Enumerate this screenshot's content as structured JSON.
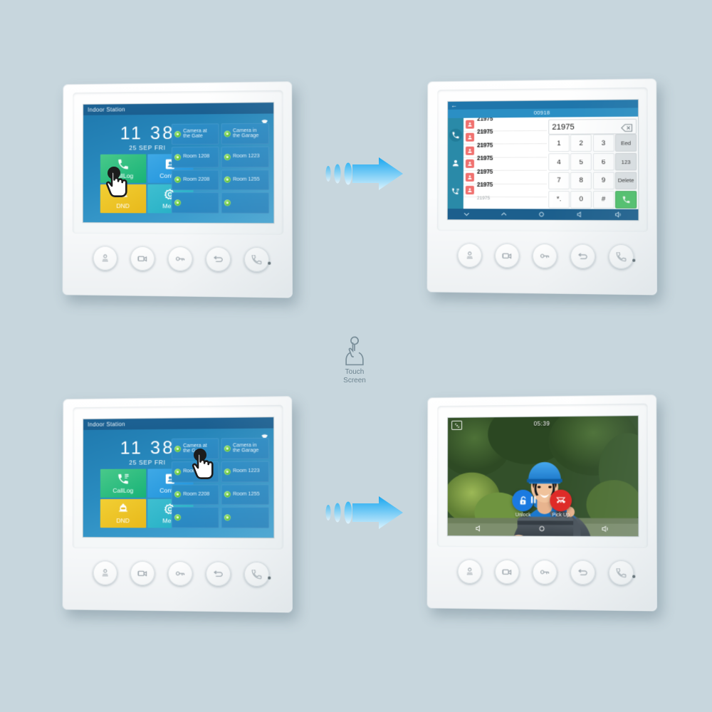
{
  "background_color": "#c7d6dd",
  "center_note": {
    "icon": "touch-hand-icon",
    "line1": "Touch",
    "line2": "Screen"
  },
  "devices": {
    "top_left": {
      "name": "indoor-station-home-calllog",
      "screen_type": "home",
      "status_bar_title": "Indoor Station",
      "wifi_icon": "wifi-icon",
      "clock": {
        "time": "11 38",
        "date": "25 SEP FRI"
      },
      "function_tiles": [
        {
          "label": "CallLog",
          "icon": "call-log-icon",
          "color": "#18b378"
        },
        {
          "label": "Contact",
          "icon": "contact-book-icon",
          "color": "#1f93dc"
        },
        {
          "label": "DND",
          "icon": "dnd-icon",
          "color": "#e8b91b"
        },
        {
          "label": "Menu",
          "icon": "gear-icon",
          "color": "#23aec4"
        }
      ],
      "room_tiles": [
        {
          "label": "Camera at\nthe Gate",
          "status": "online"
        },
        {
          "label": "Camera in\nthe Garage",
          "status": "online"
        },
        {
          "label": "Room 1208",
          "status": "online"
        },
        {
          "label": "Room 1223",
          "status": "online"
        },
        {
          "label": "Room 2208",
          "status": "online"
        },
        {
          "label": "Room 1255",
          "status": "online"
        },
        {
          "label": "",
          "status": "online"
        },
        {
          "label": "",
          "status": "online"
        }
      ],
      "hand_pointer_target": "CallLog",
      "hardware_buttons": [
        "monitor-icon",
        "video-icon",
        "unlock-key-icon",
        "back-icon",
        "call-icon"
      ]
    },
    "top_right": {
      "name": "indoor-station-dial-keypad",
      "screen_type": "keypad",
      "back_icon": "arrow-left-icon",
      "header_title": "00918",
      "side_tabs": [
        {
          "icon": "phone-dial-icon",
          "active": true
        },
        {
          "icon": "contacts-person-icon",
          "active": false
        },
        {
          "icon": "call-history-icon",
          "active": false
        }
      ],
      "contact_rows": [
        {
          "name": "21975",
          "sub": "21975"
        },
        {
          "name": "21975",
          "sub": "21975"
        },
        {
          "name": "21975",
          "sub": "21975"
        },
        {
          "name": "21975",
          "sub": "21975"
        },
        {
          "name": "21975",
          "sub": "21975"
        },
        {
          "name": "21975",
          "sub": "21975"
        }
      ],
      "dial_input_value": "21975",
      "backspace_icon": "backspace-icon",
      "keypad_keys": [
        "1",
        "2",
        "3",
        "Eed",
        "4",
        "5",
        "6",
        "123",
        "7",
        "8",
        "9",
        "Delete",
        "*.",
        "0",
        "#",
        "call-icon"
      ],
      "nav_icons": [
        "chevron-down-icon",
        "chevron-up-icon",
        "home-circle-icon",
        "volume-down-icon",
        "volume-up-icon"
      ],
      "hardware_buttons": [
        "monitor-icon",
        "video-icon",
        "unlock-key-icon",
        "back-icon",
        "call-icon"
      ]
    },
    "bottom_left": {
      "name": "indoor-station-home-camera",
      "screen_type": "home",
      "status_bar_title": "Indoor Station",
      "wifi_icon": "wifi-icon",
      "clock": {
        "time": "11 38",
        "date": "25 SEP FRI"
      },
      "function_tiles": [
        {
          "label": "CallLog",
          "icon": "call-log-icon",
          "color": "#18b378"
        },
        {
          "label": "Contact",
          "icon": "contact-book-icon",
          "color": "#1f93dc"
        },
        {
          "label": "DND",
          "icon": "dnd-icon",
          "color": "#e8b91b"
        },
        {
          "label": "Menu",
          "icon": "gear-icon",
          "color": "#23aec4"
        }
      ],
      "room_tiles": [
        {
          "label": "Camera at\nthe Gate",
          "status": "online"
        },
        {
          "label": "Camera in\nthe Garage",
          "status": "online"
        },
        {
          "label": "Room 1208",
          "status": "online"
        },
        {
          "label": "Room 1223",
          "status": "online"
        },
        {
          "label": "Room 2208",
          "status": "online"
        },
        {
          "label": "Room 1255",
          "status": "online"
        },
        {
          "label": "",
          "status": "online"
        },
        {
          "label": "",
          "status": "online"
        }
      ],
      "hand_pointer_target": "Camera at the Gate",
      "hardware_buttons": [
        "monitor-icon",
        "video-icon",
        "unlock-key-icon",
        "back-icon",
        "call-icon"
      ]
    },
    "bottom_right": {
      "name": "indoor-station-video-call",
      "screen_type": "video",
      "capture_icon": "snapshot-icon",
      "call_timer": "05:39",
      "video_subject": "delivery courier in blue helmet and jacket holding a parcel, green garden background",
      "controls": [
        {
          "label": "Unlock",
          "icon": "unlock-padlock-icon",
          "color": "#1b7ae0"
        },
        {
          "label": "Pick Up",
          "icon": "hangup-phone-icon",
          "color": "#df2a27"
        }
      ],
      "overlay_icons": [
        "pause-icon",
        "snapshot-capture-icon"
      ],
      "bottom_icons": [
        "volume-down-icon",
        "home-circle-icon",
        "volume-up-icon"
      ],
      "hardware_buttons": [
        "monitor-icon",
        "video-icon",
        "unlock-key-icon",
        "back-icon",
        "call-icon"
      ]
    }
  },
  "arrows": [
    {
      "name": "flow-arrow-top",
      "direction": "right",
      "color": "#2aa9ef"
    },
    {
      "name": "flow-arrow-bottom",
      "direction": "right",
      "color": "#2aa9ef"
    }
  ]
}
